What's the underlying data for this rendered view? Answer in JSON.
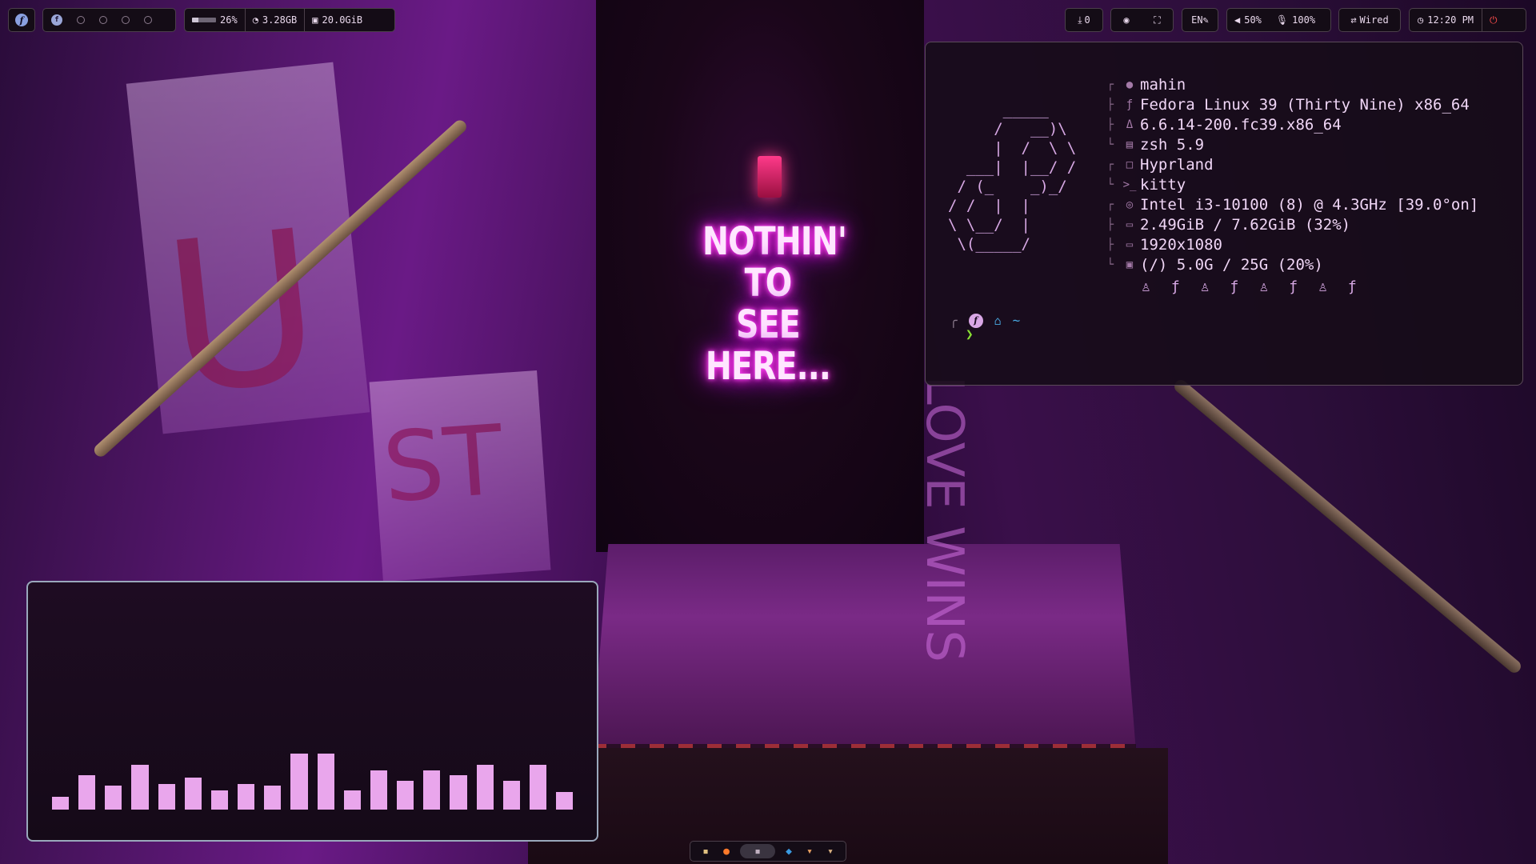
{
  "wallpaper": {
    "neon_line1": "NOTHIN' TO",
    "neon_line2": "SEE HERE...",
    "wall_text": "LOVE WINS"
  },
  "topbar": {
    "menu_icon": "fedora-logo",
    "workspaces": [
      {
        "state": "active"
      },
      {
        "state": "empty"
      },
      {
        "state": "empty"
      },
      {
        "state": "empty"
      },
      {
        "state": "empty"
      }
    ],
    "system": {
      "cpu_percent": 26,
      "cpu_label": "26%",
      "memory": "3.28GB",
      "disk": "20.0GiB"
    },
    "updates_count": "0",
    "keyboard_layout": "EN",
    "volume": "50%",
    "mic": "100%",
    "network": "Wired",
    "clock": "12:20 PM"
  },
  "terminal": {
    "ascii_logo": "      _____\n     /   __)\\\n     |  /  \\ \\\n  ___|  |__/ /\n / (_    _)_/\n/ /  |  |\n\\ \\__/  |\n \\(_____/",
    "info": [
      {
        "icon": "user-icon",
        "glyph": "●",
        "value": "mahin"
      },
      {
        "icon": "os-icon",
        "glyph": "ƒ",
        "value": "Fedora Linux 39 (Thirty Nine) x86_64"
      },
      {
        "icon": "kernel-icon",
        "glyph": "Δ",
        "value": "6.6.14-200.fc39.x86_64"
      },
      {
        "icon": "shell-icon",
        "glyph": "▤",
        "value": "zsh 5.9"
      },
      {
        "icon": "wm-icon",
        "glyph": "□",
        "value": "Hyprland"
      },
      {
        "icon": "terminal-icon",
        "glyph": ">_",
        "value": "kitty"
      },
      {
        "icon": "cpu-icon",
        "glyph": "◎",
        "value": "Intel i3-10100 (8) @ 4.3GHz [39.0°on]"
      },
      {
        "icon": "memory-icon",
        "glyph": "▭",
        "value": "2.49GiB / 7.62GiB (32%)"
      },
      {
        "icon": "display-icon",
        "glyph": "▭",
        "value": "1920x1080"
      },
      {
        "icon": "disk-icon",
        "glyph": "▣",
        "value": "(/)  5.0G / 25G (20%)"
      }
    ],
    "color_icons": [
      "tux-icon",
      "fedora-icon",
      "tux-icon",
      "fedora-icon",
      "tux-icon",
      "fedora-icon",
      "tux-icon",
      "fedora-icon"
    ],
    "prompt": {
      "dir": "~",
      "char": "❯"
    }
  },
  "visualizer": {
    "levels": [
      0.18,
      0.48,
      0.33,
      0.62,
      0.36,
      0.44,
      0.27,
      0.36,
      0.33,
      0.78,
      0.78,
      0.27,
      0.54,
      0.4,
      0.54,
      0.48,
      0.62,
      0.4,
      0.62,
      0.24
    ],
    "bar_color": "#e9a6ec"
  },
  "dock": {
    "apps": [
      "system-monitor-icon",
      "firefox-icon",
      "terminal-icon",
      "vscode-icon",
      "file-manager-icon",
      "kitty-icon"
    ]
  },
  "colors": {
    "accent": "#e9a6ec",
    "panel_border": "#4b3f4a",
    "power": "#ff4d4d"
  }
}
